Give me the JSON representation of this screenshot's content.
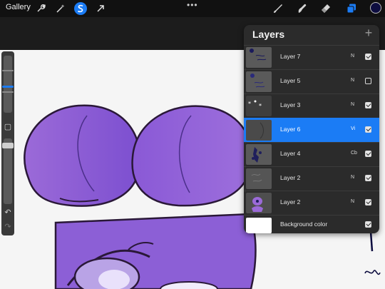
{
  "topbar": {
    "gallery_label": "Gallery",
    "more_glyph": "•••",
    "left_tools": [
      "wrench-icon",
      "magic-wand-icon",
      "selection-s-icon",
      "transform-arrow-icon"
    ],
    "right_tools": [
      "brush-icon",
      "smudge-icon",
      "eraser-icon",
      "layers-icon"
    ],
    "active_color": "#0d0d3f",
    "accent": "#1b7cf5"
  },
  "sidebar": {
    "undo_glyph": "↶",
    "redo_glyph": "↷",
    "modify_glyph": "▢"
  },
  "layers_panel": {
    "title": "Layers",
    "add_glyph": "+",
    "rows": [
      {
        "name": "Layer 7",
        "mode": "N",
        "visible": true,
        "selected": false
      },
      {
        "name": "Layer 5",
        "mode": "N",
        "visible": false,
        "selected": false
      },
      {
        "name": "Layer 3",
        "mode": "N",
        "visible": true,
        "selected": false
      },
      {
        "name": "Layer 6",
        "mode": "Vi",
        "visible": true,
        "selected": true
      },
      {
        "name": "Layer 4",
        "mode": "Cb",
        "visible": true,
        "selected": false
      },
      {
        "name": "Layer 2",
        "mode": "N",
        "visible": true,
        "selected": false
      },
      {
        "name": "Layer 2",
        "mode": "N",
        "visible": true,
        "selected": false
      },
      {
        "name": "Background color",
        "mode": "",
        "visible": true,
        "selected": false
      }
    ]
  }
}
